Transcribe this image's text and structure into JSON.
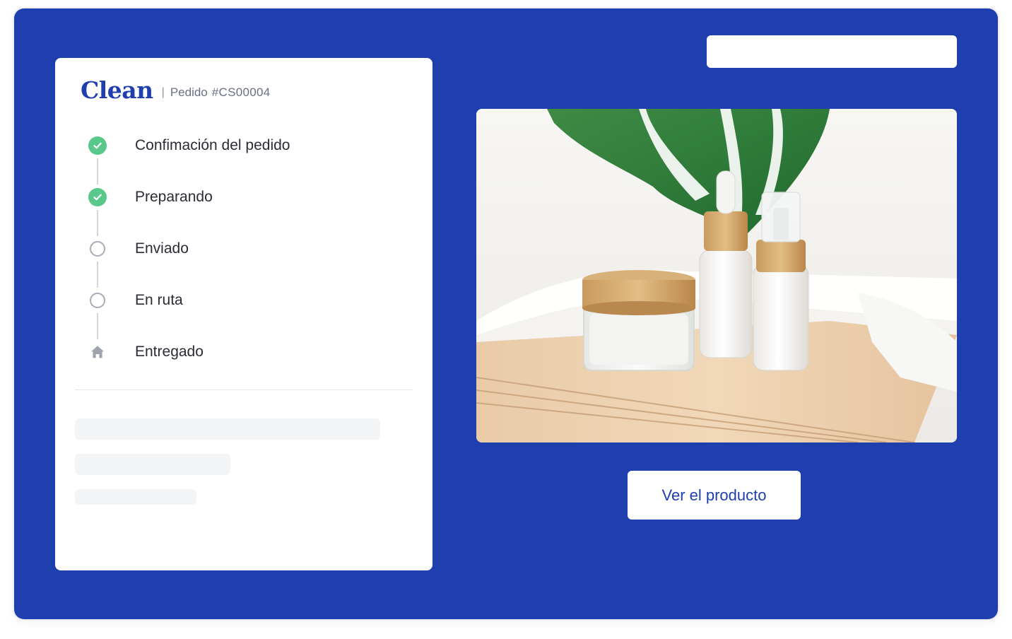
{
  "brand": {
    "name": "Clean",
    "separator": "|",
    "order_label": "Pedido",
    "order_id": "#CS00004"
  },
  "steps": [
    {
      "label": "Confimación del pedido",
      "status": "done",
      "icon": "check-circle-icon"
    },
    {
      "label": "Preparando",
      "status": "done",
      "icon": "check-circle-icon"
    },
    {
      "label": "Enviado",
      "status": "pending",
      "icon": "empty-circle-icon"
    },
    {
      "label": "En ruta",
      "status": "pending",
      "icon": "empty-circle-icon"
    },
    {
      "label": "Entregado",
      "status": "pending",
      "icon": "home-icon"
    }
  ],
  "product": {
    "cta_label": "Ver el producto"
  },
  "colors": {
    "background": "#1f3fae",
    "accent": "#1f3fae",
    "success": "#58c98a",
    "pending": "#a9acb6"
  }
}
